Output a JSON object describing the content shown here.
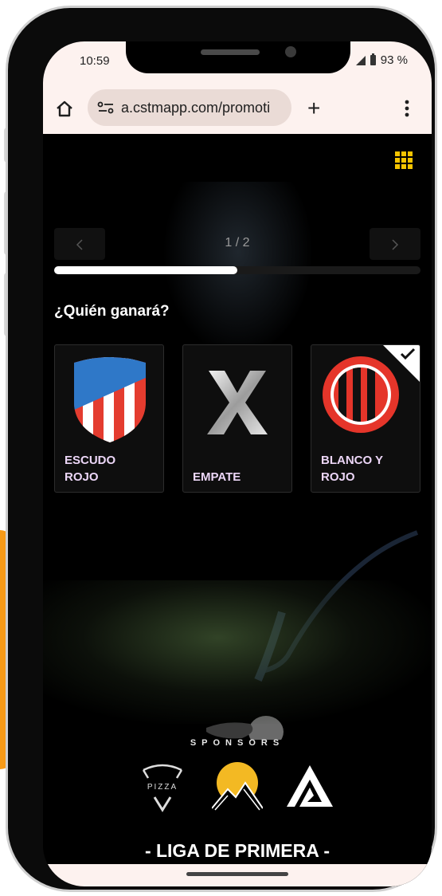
{
  "status_bar": {
    "time": "10:59",
    "battery": "93 %"
  },
  "browser": {
    "url": "a.cstmapp.com/promoti",
    "new_tab_glyph": "+"
  },
  "quiz": {
    "page_indicator": "1 / 2",
    "progress_fraction": 0.5,
    "question": "¿Quién ganará?",
    "options": [
      {
        "label_line1": "ESCUDO",
        "label_line2": "ROJO",
        "icon": "red-white-shield-icon",
        "selected": false
      },
      {
        "label_line1": "EMPATE",
        "label_line2": "",
        "icon": "x-draw-icon",
        "selected": false
      },
      {
        "label_line1": "BLANCO Y",
        "label_line2": "ROJO",
        "icon": "red-black-striped-circle-icon",
        "selected": true
      }
    ]
  },
  "sponsors": {
    "title": "SPONSORS",
    "logos": [
      {
        "name": "pizza-logo",
        "text": "PIZZA"
      },
      {
        "name": "mountain-sun-logo",
        "text": ""
      },
      {
        "name": "triangle-a-logo",
        "text": ""
      }
    ]
  },
  "league_title": "- LIGA DE PRIMERA -",
  "colors": {
    "accent": "#f5c400",
    "label": "#ecd6f7",
    "browser_bg": "#fdf2ef"
  }
}
